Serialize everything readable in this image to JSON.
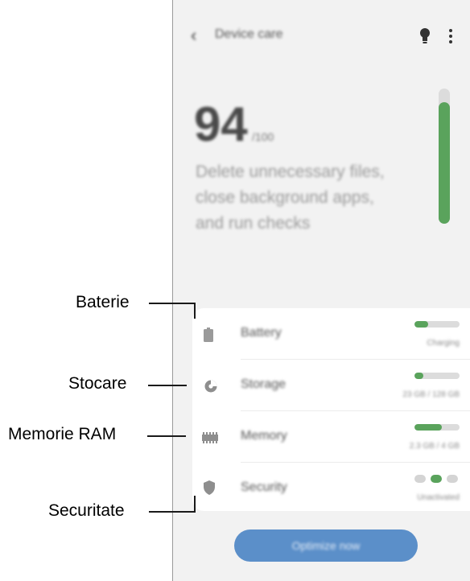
{
  "header": {
    "back_glyph": "‹",
    "title": "Device care",
    "icons": [
      "lightbulb-icon",
      "more-options-icon"
    ]
  },
  "summary": {
    "score": "94",
    "score_unit": "/100",
    "tip": "Delete unnecessary files, close background apps, and run checks",
    "meter_level": 0.9
  },
  "items": [
    {
      "label": "Battery",
      "status": "Charging",
      "level": 0.3,
      "icon": "battery-icon"
    },
    {
      "label": "Storage",
      "status": "23 GB / 128 GB",
      "level": 0.2,
      "icon": "storage-icon"
    },
    {
      "label": "Memory",
      "status": "2.3 GB / 4 GB",
      "level": 0.6,
      "icon": "memory-icon"
    },
    {
      "label": "Security",
      "status": "Unactivated",
      "icon": "shield-icon"
    }
  ],
  "optimize_button": "Optimize now",
  "callouts": [
    "Baterie",
    "Stocare",
    "Memorie RAM",
    "Securitate"
  ],
  "colors": {
    "accent_green": "#5aa35c",
    "button_blue": "#5b8fc9",
    "screen_bg": "#f2f2f2"
  }
}
